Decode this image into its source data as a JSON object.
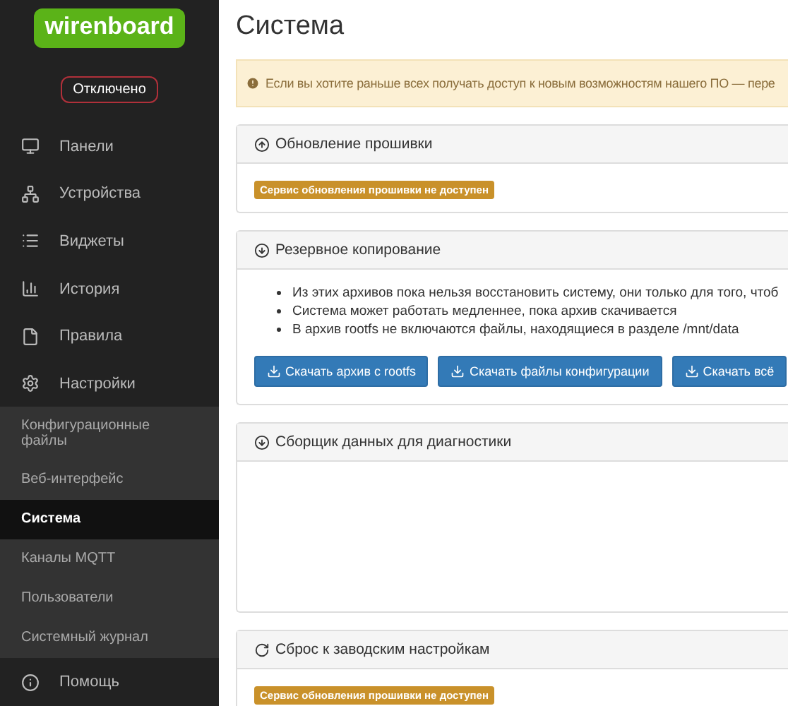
{
  "logo": "wirenboard",
  "connection_status": "Отключено",
  "nav": [
    {
      "label": "Панели"
    },
    {
      "label": "Устройства"
    },
    {
      "label": "Виджеты"
    },
    {
      "label": "История"
    },
    {
      "label": "Правила"
    },
    {
      "label": "Настройки"
    }
  ],
  "settings_submenu": [
    {
      "label": "Конфигурационные файлы",
      "selected": false
    },
    {
      "label": "Веб-интерфейс",
      "selected": false
    },
    {
      "label": "Система",
      "selected": true
    },
    {
      "label": "Каналы MQTT",
      "selected": false
    },
    {
      "label": "Пользователи",
      "selected": false
    },
    {
      "label": "Системный журнал",
      "selected": false
    }
  ],
  "help": "Помощь",
  "page_title": "Система",
  "alert": "Если вы хотите раньше всех получать доступ к новым возможностям нашего ПО — пере",
  "panels": [
    {
      "kind": "update",
      "title": "Обновление прошивки",
      "badge": "Сервис обновления прошивки не доступен"
    },
    {
      "kind": "backup",
      "title": "Резервное копирование",
      "notes": [
        "Из этих архивов пока нельзя восстановить систему, они только для того, чтоб",
        "Система может работать медленнее, пока архив скачивается",
        "В архив rootfs не включаются файлы, находящиеся в разделе /mnt/data"
      ],
      "buttons": [
        "Скачать архив с rootfs",
        "Скачать файлы конфигурации",
        "Скачать всё"
      ]
    },
    {
      "kind": "diagnostics",
      "title": "Сборщик данных для диагностики"
    },
    {
      "kind": "reset",
      "title": "Сброс к заводским настройкам",
      "badge": "Сервис обновления прошивки не доступен"
    }
  ]
}
